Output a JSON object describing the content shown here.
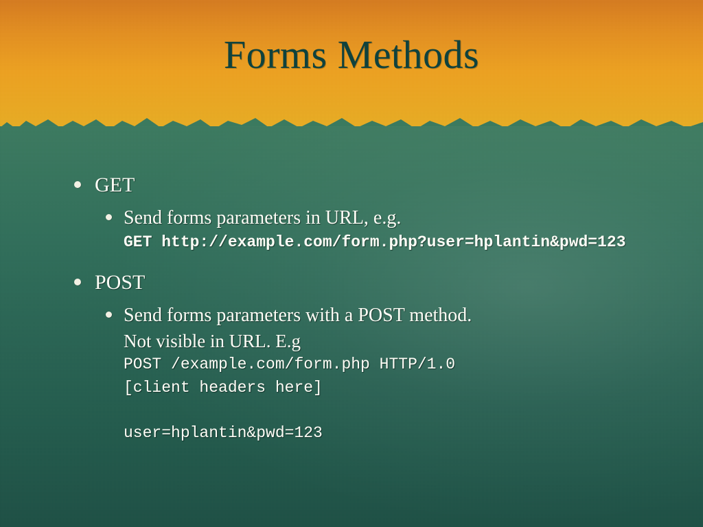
{
  "title": "Forms Methods",
  "bullets": {
    "get": {
      "label": "GET",
      "sub": "Send forms parameters in URL, e.g.",
      "code": "GET http://example.com/form.php?user=hplantin&pwd=123"
    },
    "post": {
      "label": "POST",
      "sub": "Send forms parameters with a POST method.",
      "note": "Not visible in URL. E.g",
      "code": "POST /example.com/form.php HTTP/1.0\n[client headers here]\n\nuser=hplantin&pwd=123"
    }
  }
}
